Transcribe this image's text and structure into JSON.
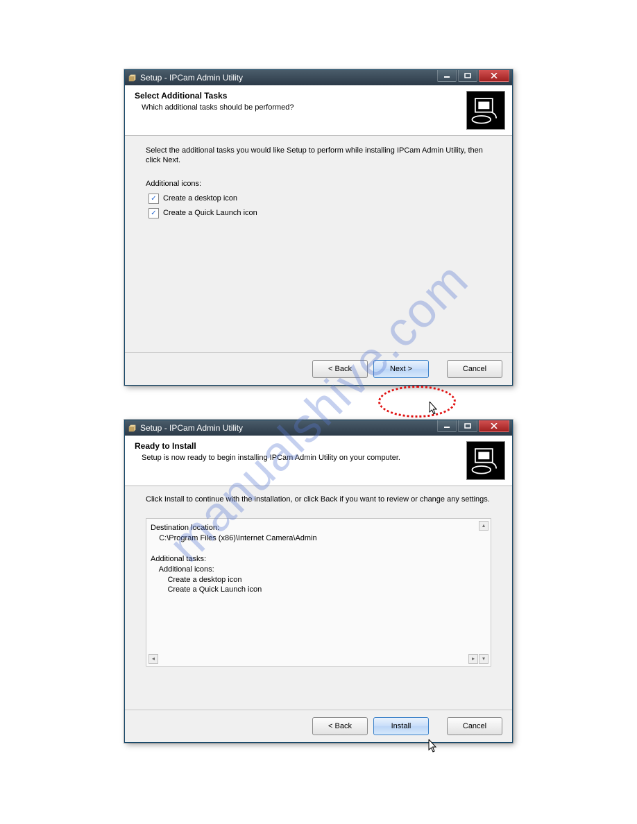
{
  "watermark": "manualshive.com",
  "dialog1": {
    "title": "Setup - IPCam Admin Utility",
    "header_title": "Select Additional Tasks",
    "header_sub": "Which additional tasks should be performed?",
    "instruction": "Select the additional tasks you would like Setup to perform while installing IPCam Admin Utility, then click Next.",
    "section_label": "Additional icons:",
    "cb1_label": "Create a desktop icon",
    "cb1_checked": true,
    "cb2_label": "Create a Quick Launch icon",
    "cb2_checked": true,
    "btn_back": "< Back",
    "btn_next": "Next >",
    "btn_cancel": "Cancel"
  },
  "dialog2": {
    "title": "Setup - IPCam Admin Utility",
    "header_title": "Ready to Install",
    "header_sub": "Setup is now ready to begin installing IPCam Admin Utility on your computer.",
    "instruction": "Click Install to continue with the installation, or click Back if you want to review or change any settings.",
    "summary": "Destination location:\n    C:\\Program Files (x86)\\Internet Camera\\Admin\n\nAdditional tasks:\n    Additional icons:\n        Create a desktop icon\n        Create a Quick Launch icon",
    "btn_back": "< Back",
    "btn_install": "Install",
    "btn_cancel": "Cancel"
  }
}
